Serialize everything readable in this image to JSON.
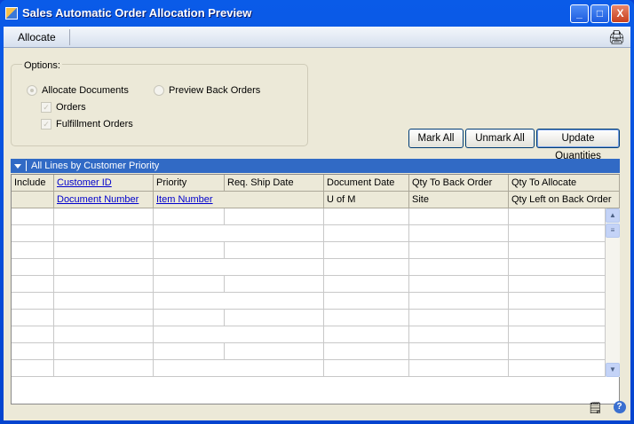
{
  "window": {
    "title": "Sales Automatic Order Allocation Preview",
    "min": "_",
    "max": "□",
    "close": "X"
  },
  "toolbar": {
    "allocate": "Allocate"
  },
  "options": {
    "label": "Options:",
    "allocate_documents": "Allocate Documents",
    "preview_back_orders": "Preview Back Orders",
    "orders": "Orders",
    "fulfillment_orders": "Fulfillment Orders"
  },
  "buttons": {
    "mark_all": "Mark All",
    "unmark_all": "Unmark All",
    "update_quantities": "Update Quantities"
  },
  "grid": {
    "title": "All Lines by Customer Priority",
    "header1": [
      "Include",
      "Customer ID",
      "Priority",
      "Req. Ship Date",
      "Document Date",
      "Qty To Back Order",
      "Qty To Allocate"
    ],
    "header2": [
      "",
      "Document Number",
      "Item Number",
      "U of M",
      "Site",
      "Qty Left on Back Order"
    ]
  },
  "icons": {
    "help": "?"
  }
}
